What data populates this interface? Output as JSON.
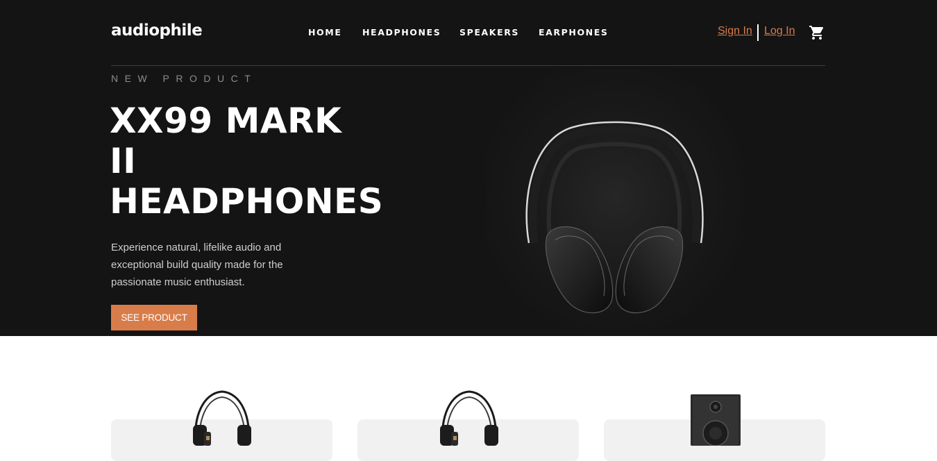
{
  "header": {
    "logo": "audiophile",
    "nav": [
      {
        "label": "HOME"
      },
      {
        "label": "HEADPHONES"
      },
      {
        "label": "SPEAKERS"
      },
      {
        "label": "EARPHONES"
      }
    ],
    "sign_in": "Sign In",
    "log_in": "Log In",
    "cart_icon": "cart-icon"
  },
  "hero": {
    "overline": "NEW PRODUCT",
    "title_lines": [
      "XX99 MARK",
      "II",
      "HEADPHONES"
    ],
    "description": "Experience natural, lifelike audio and exceptional build quality made for the passionate music enthusiast.",
    "cta": "SEE PRODUCT",
    "image": "headphones-image"
  },
  "categories": [
    {
      "image": "headphones-thumbnail"
    },
    {
      "image": "headphones-thumbnail"
    },
    {
      "image": "speaker-thumbnail"
    }
  ],
  "colors": {
    "accent": "#d87d4a",
    "hero_bg": "#141414",
    "card_bg": "#f1f1f1"
  }
}
